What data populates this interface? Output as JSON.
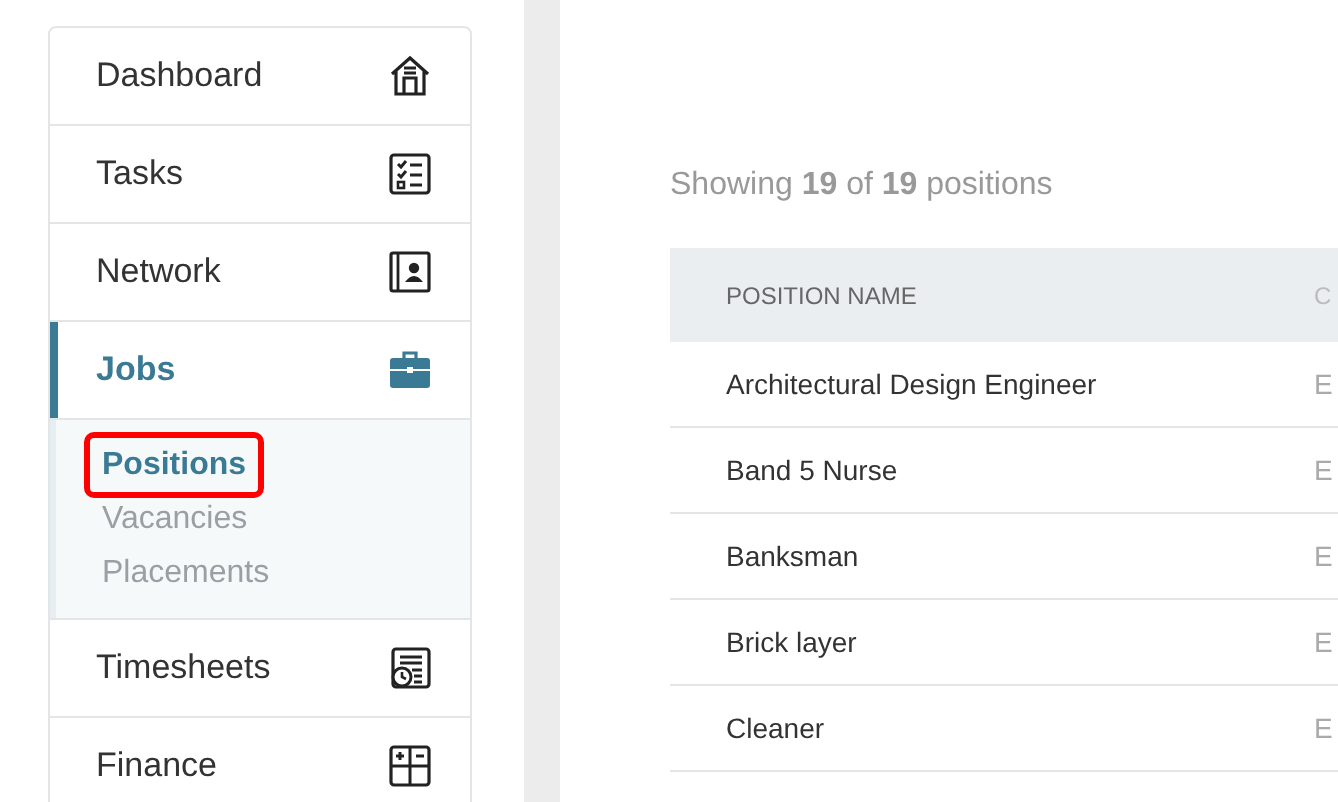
{
  "sidebar": {
    "items": [
      {
        "label": "Dashboard",
        "selected": false
      },
      {
        "label": "Tasks",
        "selected": false
      },
      {
        "label": "Network",
        "selected": false
      },
      {
        "label": "Jobs",
        "selected": true,
        "expanded": true,
        "children": [
          {
            "label": "Positions",
            "selected": true,
            "highlighted": true
          },
          {
            "label": "Vacancies",
            "selected": false,
            "highlighted": false
          },
          {
            "label": "Placements",
            "selected": false,
            "highlighted": false
          }
        ]
      },
      {
        "label": "Timesheets",
        "selected": false
      },
      {
        "label": "Finance",
        "selected": false
      }
    ]
  },
  "summary": "Showing **19** of **19** positions",
  "table": {
    "columns": [
      "POSITION NAME",
      "C"
    ],
    "rows": [
      [
        "Architectural Design Engineer",
        "E"
      ],
      [
        "Band 5 Nurse",
        "E"
      ],
      [
        "Banksman",
        "E"
      ],
      [
        "Brick layer",
        "E"
      ],
      [
        "Cleaner",
        "E"
      ]
    ]
  }
}
